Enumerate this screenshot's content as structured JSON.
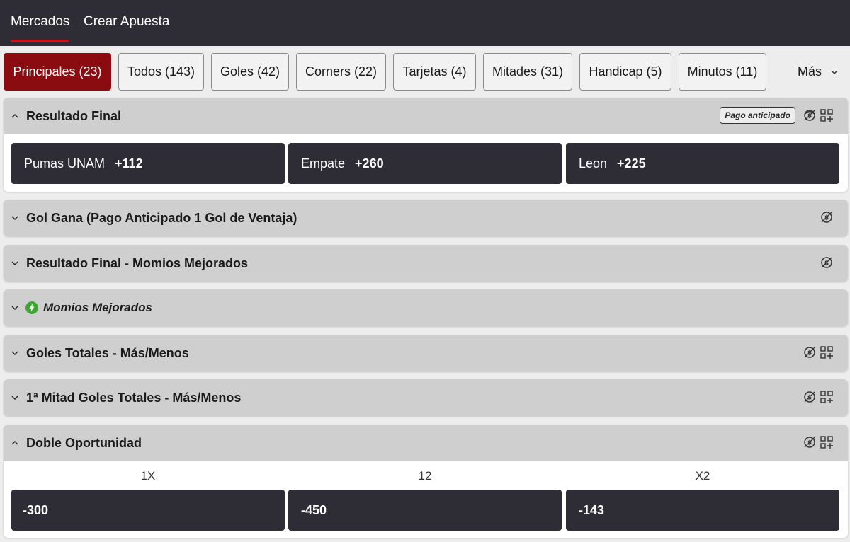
{
  "top_tabs": [
    {
      "label": "Mercados",
      "active": true
    },
    {
      "label": "Crear Apuesta",
      "active": false
    }
  ],
  "filters": [
    {
      "label": "Principales (23)",
      "active": true
    },
    {
      "label": "Todos (143)"
    },
    {
      "label": "Goles (42)"
    },
    {
      "label": "Corners (22)"
    },
    {
      "label": "Tarjetas (4)"
    },
    {
      "label": "Mitades (31)"
    },
    {
      "label": "Handicap (5)"
    },
    {
      "label": "Minutos (11)"
    }
  ],
  "more_label": "Más",
  "colors": {
    "dark": "#2e2d36",
    "accent": "#8a0c10",
    "underline": "#c4141c",
    "bolt": "#3ea534"
  },
  "sections": {
    "resultado_final": {
      "title": "Resultado Final",
      "badge": "Pago anticipado",
      "odds": [
        {
          "name": "Pumas UNAM",
          "price": "+112"
        },
        {
          "name": "Empate",
          "price": "+260"
        },
        {
          "name": "Leon",
          "price": "+225"
        }
      ]
    },
    "gol_gana": {
      "title": "Gol Gana (Pago Anticipado 1 Gol de Ventaja)"
    },
    "resultado_mejorados": {
      "title": "Resultado Final - Momios Mejorados"
    },
    "momios_mejorados": {
      "title": "Momios Mejorados"
    },
    "goles_totales": {
      "title": "Goles Totales - Más/Menos"
    },
    "mitad_goles": {
      "title": "1ª Mitad Goles Totales - Más/Menos"
    },
    "doble_oportunidad": {
      "title": "Doble Oportunidad",
      "columns": [
        "1X",
        "12",
        "X2"
      ],
      "odds": [
        "-300",
        "-450",
        "-143"
      ]
    }
  }
}
